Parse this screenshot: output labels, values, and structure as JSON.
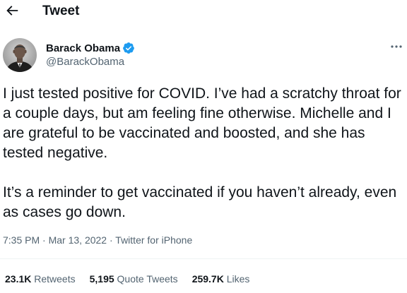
{
  "header": {
    "title": "Tweet",
    "back_icon": "arrow-left-icon"
  },
  "author": {
    "name": "Barack Obama",
    "handle": "@BarackObama",
    "verified_icon": "verified-badge-icon",
    "verified_color": "#1d9bf0",
    "more_icon": "more-horizontal-icon"
  },
  "tweet": {
    "paragraph1": "I just tested positive for COVID. I’ve had a scratchy throat for a couple days, but am feeling fine otherwise. Michelle and I are grateful to be vaccinated and boosted, and she has tested negative.",
    "paragraph2": "It’s a reminder to get vaccinated if you haven’t already, even as cases go down."
  },
  "meta": {
    "time": "7:35 PM",
    "separator": "·",
    "date": "Mar 13, 2022",
    "source": "Twitter for iPhone"
  },
  "stats": {
    "retweets_count": "23.1K",
    "retweets_label": "Retweets",
    "quote_count": "5,195",
    "quote_label": "Quote Tweets",
    "likes_count": "259.7K",
    "likes_label": "Likes"
  },
  "colors": {
    "text_primary": "#0f1419",
    "text_secondary": "#536471",
    "accent": "#1d9bf0"
  }
}
